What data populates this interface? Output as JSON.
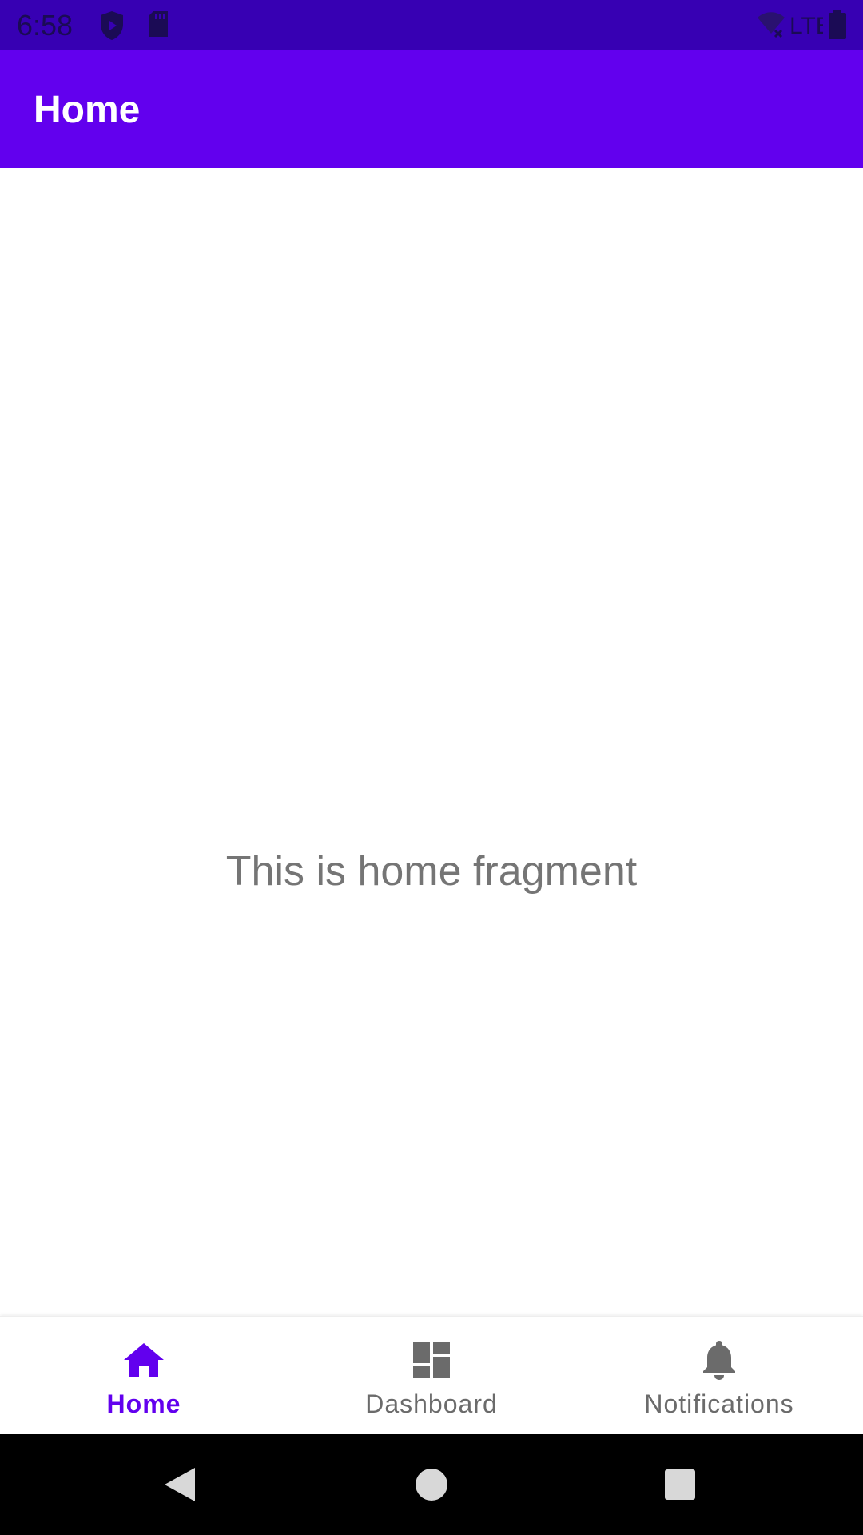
{
  "status_bar": {
    "time": "6:58",
    "icons": [
      "shield-icon",
      "sd-card-icon",
      "wifi-off-icon",
      "signal-lte-icon",
      "battery-icon"
    ],
    "network_label": "LTE",
    "color": "#3700B3"
  },
  "app_bar": {
    "title": "Home",
    "color": "#6200EE"
  },
  "content": {
    "text": "This is home fragment"
  },
  "bottom_nav": {
    "items": [
      {
        "label": "Home",
        "icon": "home-icon",
        "active": true
      },
      {
        "label": "Dashboard",
        "icon": "dashboard-icon",
        "active": false
      },
      {
        "label": "Notifications",
        "icon": "bell-icon",
        "active": false
      }
    ],
    "active_color": "#6200EE",
    "inactive_color": "#6b6b6b"
  },
  "system_nav": {
    "buttons": [
      "back-icon",
      "home-circle-icon",
      "recents-icon"
    ]
  }
}
